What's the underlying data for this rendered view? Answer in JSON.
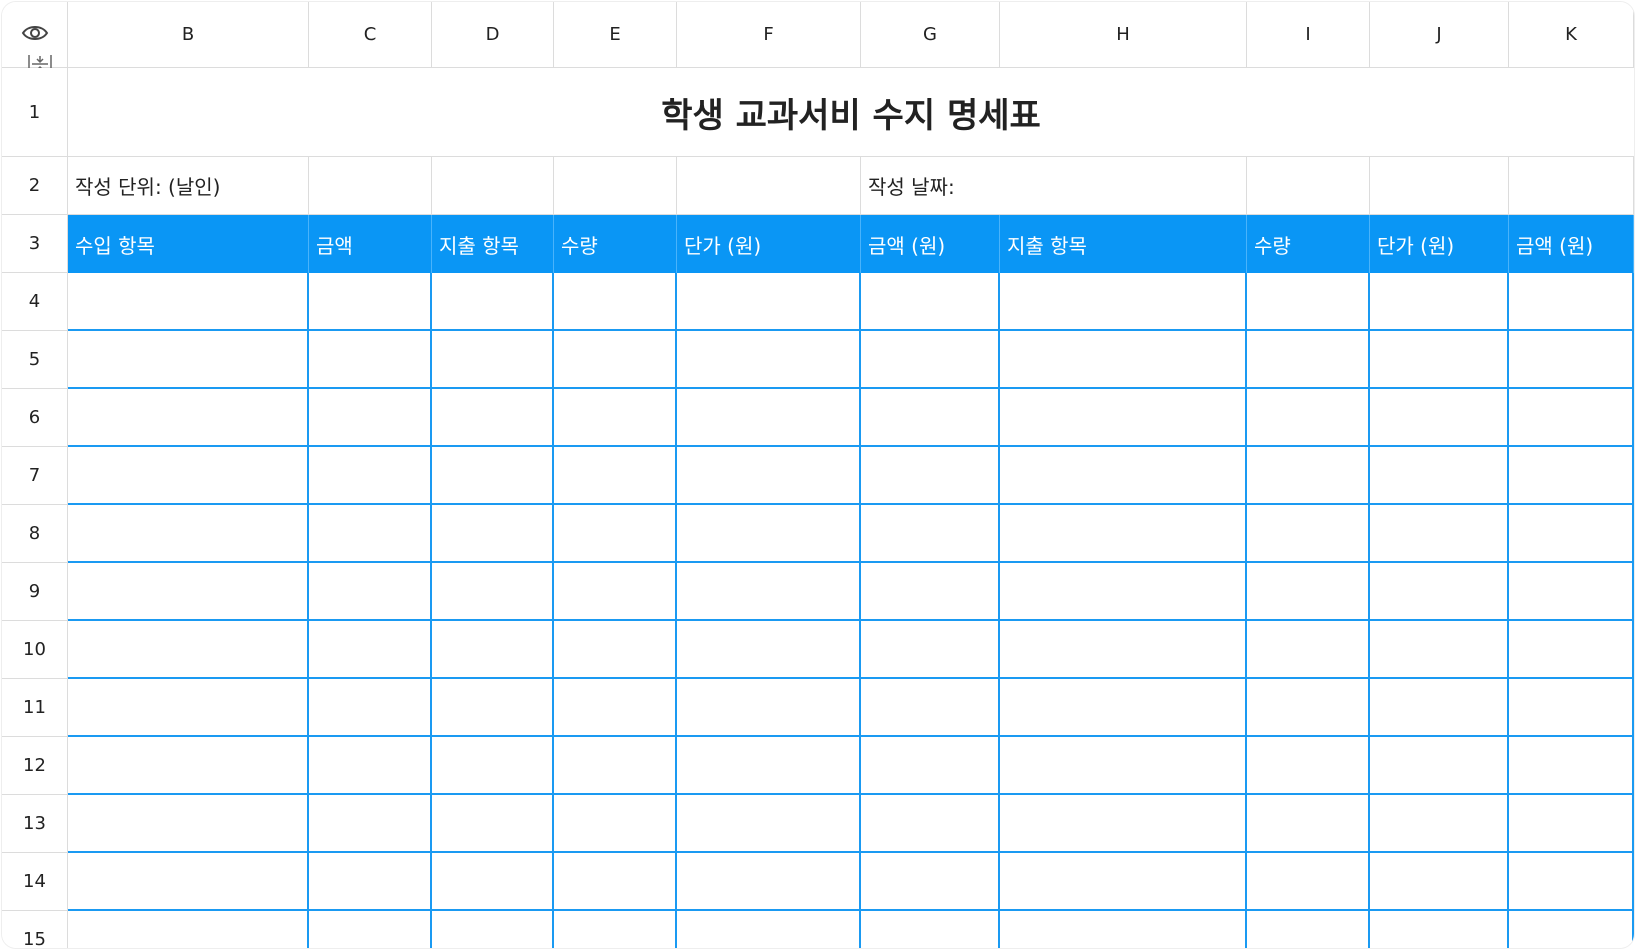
{
  "columns": [
    "B",
    "C",
    "D",
    "E",
    "F",
    "G",
    "H",
    "I",
    "J",
    "K"
  ],
  "rows": [
    "1",
    "2",
    "3",
    "4",
    "5",
    "6",
    "7",
    "8",
    "9",
    "10",
    "11",
    "12",
    "13",
    "14",
    "15"
  ],
  "title": "학생 교과서비 수지 명세표",
  "meta": {
    "unit_label": "작성 단위: (날인)",
    "date_label": "작성 날짜:"
  },
  "table_header": [
    "수입 항목",
    "금액",
    "지출 항목",
    "수량",
    "단가 (원)",
    "금액 (원)",
    "지출 항목",
    "수량",
    "단가 (원)",
    "금액 (원)"
  ],
  "icons": {
    "corner_top": "eye-icon",
    "corner_bottom": "freeze-panes-icon"
  },
  "colors": {
    "header_fill": "#0a96f5",
    "grid_line": "#1a9af2"
  }
}
